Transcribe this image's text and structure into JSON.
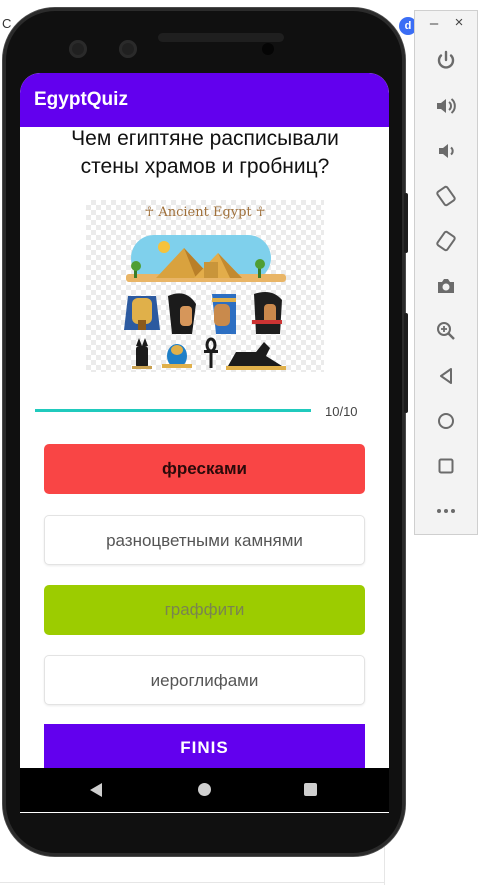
{
  "background": {
    "left_fragment": "С",
    "right_fragment": "ic",
    "badge": "d"
  },
  "app": {
    "title": "EgyptQuiz",
    "accent": "#6200ee"
  },
  "question": {
    "text": "Чем египтяне расписывали стены храмов и гробниц?",
    "image_caption": "Ancient Egypt"
  },
  "progress": {
    "fraction": 1.0,
    "label": "10/10"
  },
  "answers": [
    {
      "label": "фресками",
      "state": "wrong-selected",
      "color": "#f94545"
    },
    {
      "label": "разноцветными камнями",
      "state": "neutral"
    },
    {
      "label": "граффити",
      "state": "correct",
      "color": "#9ccc00"
    },
    {
      "label": "иероглифами",
      "state": "neutral"
    }
  ],
  "finish_button": {
    "label": "FINIS"
  },
  "navigation": {
    "icons": [
      "back-icon",
      "home-icon",
      "recents-icon"
    ]
  },
  "emulator_toolbar": {
    "minimize": "–",
    "close": "×",
    "icons": [
      "power-icon",
      "volume-up-icon",
      "volume-down-icon",
      "rotate-left-icon",
      "rotate-right-icon",
      "camera-icon",
      "zoom-icon",
      "back-icon",
      "home-icon",
      "overview-icon",
      "more-icon"
    ]
  }
}
